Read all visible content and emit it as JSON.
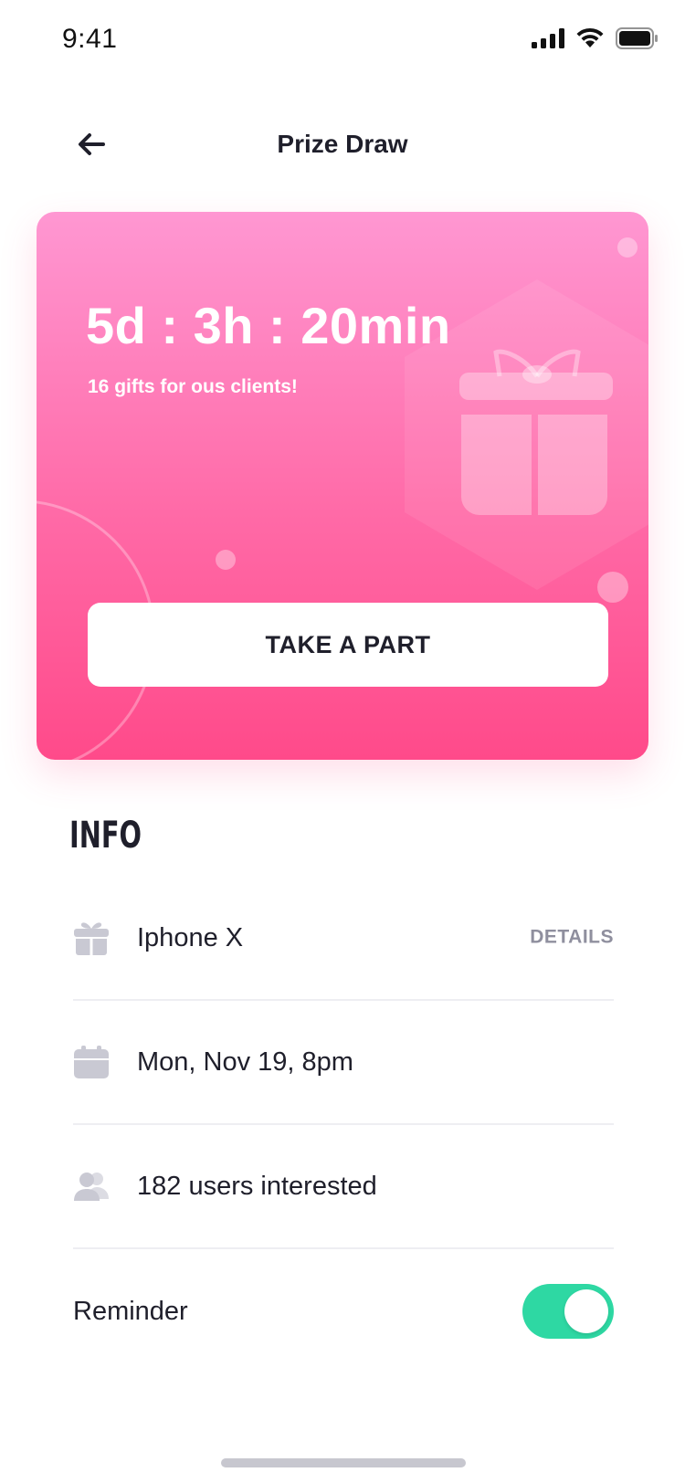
{
  "status_bar": {
    "time": "9:41"
  },
  "header": {
    "title": "Prize Draw"
  },
  "hero": {
    "countdown": "5d : 3h : 20min",
    "subtitle": "16 gifts for ous clients!",
    "button_label": "TAKE A PART"
  },
  "info": {
    "title": "INFO",
    "items": [
      {
        "icon": "gift-icon",
        "text": "Iphone X",
        "action": "DETAILS"
      },
      {
        "icon": "calendar-icon",
        "text": "Mon, Nov 19, 8pm"
      },
      {
        "icon": "users-icon",
        "text": "182 users interested"
      }
    ],
    "reminder": {
      "label": "Reminder",
      "enabled": true
    }
  },
  "colors": {
    "gradient_top": "#ff97d2",
    "gradient_bottom": "#ff4a8a",
    "toggle_on": "#2ed8a3",
    "icon_gray": "#c9c9d3",
    "text_dark": "#1f1f2b",
    "text_muted": "#8f8f9e"
  }
}
